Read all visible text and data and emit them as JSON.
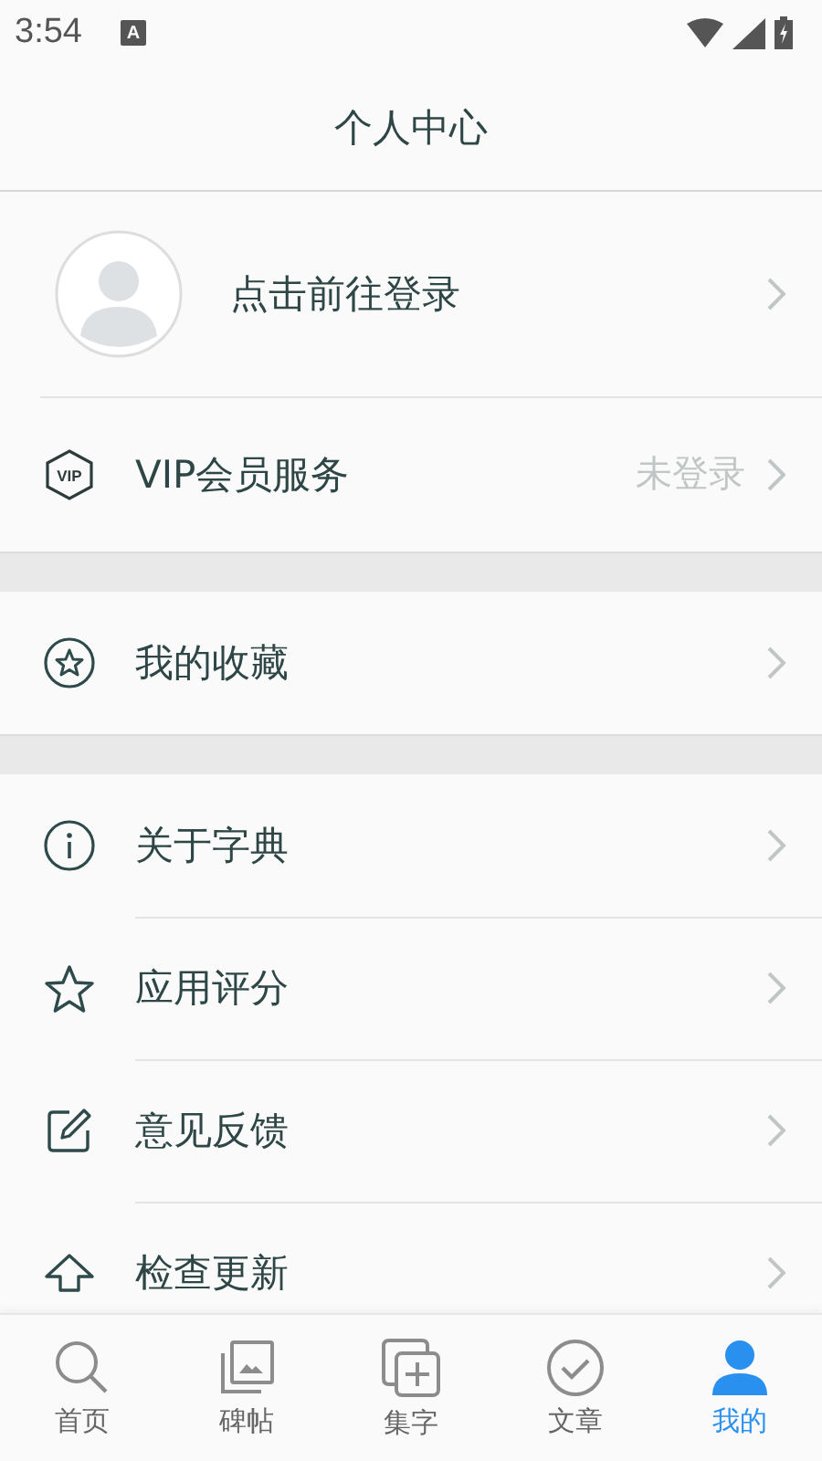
{
  "status_bar": {
    "time": "3:54",
    "notification": "A"
  },
  "header": {
    "title": "个人中心"
  },
  "profile": {
    "label": "点击前往登录"
  },
  "groups": [
    {
      "items": [
        {
          "kind": "vip",
          "badge": "VIP",
          "label": "VIP会员服务",
          "value": "未登录"
        }
      ]
    },
    {
      "items": [
        {
          "kind": "favorites",
          "label": "我的收藏"
        }
      ]
    },
    {
      "items": [
        {
          "kind": "about",
          "label": "关于字典"
        },
        {
          "kind": "rate",
          "label": "应用评分"
        },
        {
          "kind": "feedback",
          "label": "意见反馈"
        },
        {
          "kind": "update",
          "label": "检查更新"
        }
      ]
    }
  ],
  "tabs": [
    {
      "kind": "search",
      "label": "首页",
      "selected": false
    },
    {
      "kind": "gallery",
      "label": "碑帖",
      "selected": false
    },
    {
      "kind": "add",
      "label": "集字",
      "selected": false
    },
    {
      "kind": "check",
      "label": "文章",
      "selected": false
    },
    {
      "kind": "person",
      "label": "我的",
      "selected": true
    }
  ]
}
